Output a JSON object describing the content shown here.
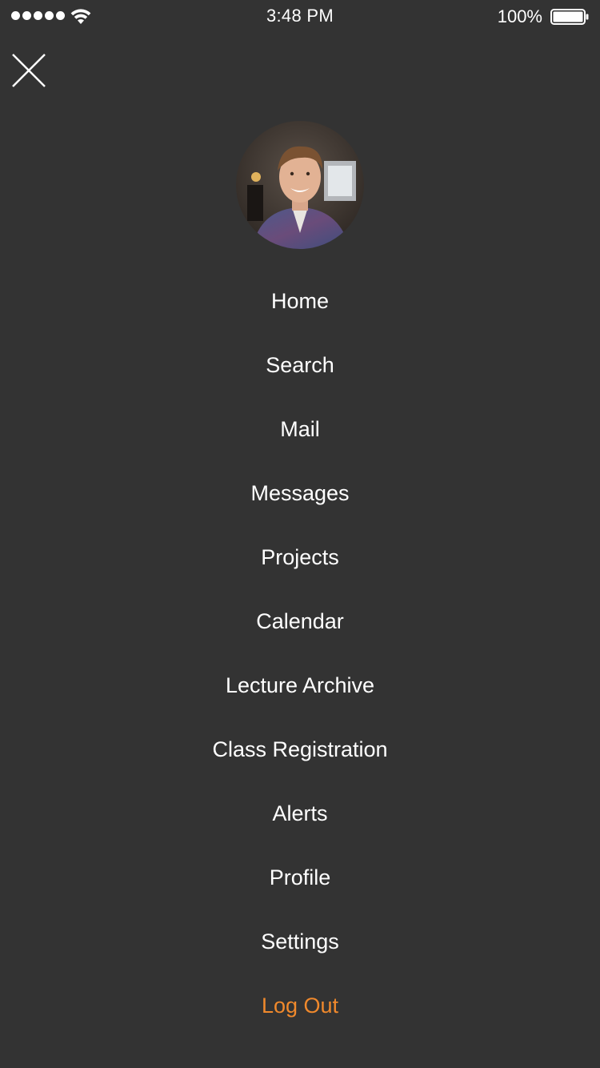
{
  "status_bar": {
    "time": "3:48 PM",
    "battery_percent": "100%",
    "signal_bars": 5,
    "battery_level": 1.0
  },
  "header": {
    "close_icon": "close-icon"
  },
  "profile": {
    "avatar_icon": "user-avatar-photo"
  },
  "menu": {
    "items": [
      {
        "label": "Home"
      },
      {
        "label": "Search"
      },
      {
        "label": "Mail"
      },
      {
        "label": "Messages"
      },
      {
        "label": "Projects"
      },
      {
        "label": "Calendar"
      },
      {
        "label": "Lecture Archive"
      },
      {
        "label": "Class Registration"
      },
      {
        "label": "Alerts"
      },
      {
        "label": "Profile"
      },
      {
        "label": "Settings"
      }
    ],
    "logout_label": "Log Out"
  },
  "colors": {
    "background": "#333333",
    "text": "#ffffff",
    "accent": "#f0892c"
  }
}
